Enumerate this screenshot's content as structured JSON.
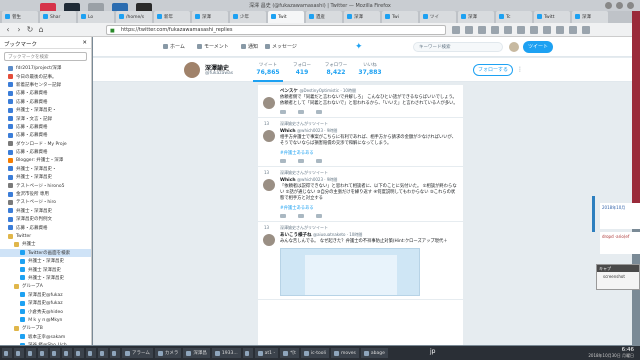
{
  "window": {
    "title": "深澤 昌史 (@fukazawamasashi) | Twitter — Mozilla Firefox"
  },
  "desktop_icons": [
    {
      "color": "#d6334a"
    },
    {
      "color": "#1e2a36"
    },
    {
      "color": "#9aa0a6"
    },
    {
      "color": "#2b6cb0"
    },
    {
      "color": "#2a2a2a"
    }
  ],
  "tabs": [
    {
      "label": "菅生"
    },
    {
      "label": "Shar"
    },
    {
      "label": "Lo"
    },
    {
      "label": "/home/s"
    },
    {
      "label": "新年"
    },
    {
      "label": "深澤"
    },
    {
      "label": "少年"
    },
    {
      "label": "Twit"
    },
    {
      "label": "遺産"
    },
    {
      "label": "深澤"
    },
    {
      "label": "Twi"
    },
    {
      "label": "ツイ"
    },
    {
      "label": "深澤"
    },
    {
      "label": "Tc"
    },
    {
      "label": "Twitt"
    },
    {
      "label": "深澤"
    }
  ],
  "navbar": {
    "url": "https://twitter.com/fukazawamasashi_replies"
  },
  "sidebar": {
    "title": "ブックマーク",
    "search_placeholder": "ブックマークを検索",
    "items": [
      {
        "label": "fdr2017/project/深澤",
        "level": 0,
        "folder": false,
        "color": "#5b8cc9"
      },
      {
        "label": "今日の最後の記事。",
        "level": 0,
        "folder": false,
        "color": "#e44d3a"
      },
      {
        "label": "新着記事センター記録",
        "level": 0,
        "folder": false,
        "color": "#3b7dd8"
      },
      {
        "label": "応募・応募資格",
        "level": 0,
        "folder": false,
        "color": "#3b7dd8"
      },
      {
        "label": "応募・応募資格",
        "level": 0,
        "folder": false,
        "color": "#3b7dd8"
      },
      {
        "label": "弁護士・深澤昌史・",
        "level": 0,
        "folder": false,
        "color": "#3b7dd8"
      },
      {
        "label": "深澤・文言・記録",
        "level": 0,
        "folder": false,
        "color": "#3b7dd8"
      },
      {
        "label": "応募・応募資格",
        "level": 0,
        "folder": false,
        "color": "#3b7dd8"
      },
      {
        "label": "応募・応募資格",
        "level": 0,
        "folder": false,
        "color": "#3b7dd8"
      },
      {
        "label": "ダウンロード - My Proje",
        "level": 0,
        "folder": false,
        "color": "#7a7a7a"
      },
      {
        "label": "応募・応募資格",
        "level": 0,
        "folder": false,
        "color": "#3b7dd8"
      },
      {
        "label": "Blogger: 弁護士・深澤",
        "level": 0,
        "folder": false,
        "color": "#f57d00"
      },
      {
        "label": "弁護士・深澤昌史・",
        "level": 0,
        "folder": false,
        "color": "#3b7dd8"
      },
      {
        "label": "弁護士・深澤昌史",
        "level": 0,
        "folder": false,
        "color": "#3b7dd8"
      },
      {
        "label": "テストページ・hirono5",
        "level": 0,
        "folder": false,
        "color": "#7a7a7a"
      },
      {
        "label": "金沢市役所 専用",
        "level": 0,
        "folder": false,
        "color": "#3b7dd8"
      },
      {
        "label": "テストページ・hiro",
        "level": 0,
        "folder": false,
        "color": "#7a7a7a"
      },
      {
        "label": "弁護士・深澤昌史",
        "level": 0,
        "folder": false,
        "color": "#3b7dd8"
      },
      {
        "label": "深澤昌史の判例文",
        "level": 0,
        "folder": false,
        "color": "#3b7dd8"
      },
      {
        "label": "応募・応募資格",
        "level": 0,
        "folder": false,
        "color": "#3b7dd8"
      },
      {
        "label": "Twitter",
        "level": 0,
        "folder": true,
        "color": "#e0b64a"
      },
      {
        "label": "弁護士",
        "level": 1,
        "folder": true,
        "color": "#e0b64a"
      },
      {
        "label": "Twitterの画面を検索",
        "level": 2,
        "folder": false,
        "color": "#1da1f2",
        "selected": true
      },
      {
        "label": "弁護士・深澤昌史",
        "level": 2,
        "folder": false,
        "color": "#1da1f2"
      },
      {
        "label": "弁護士 深澤昌史",
        "level": 2,
        "folder": false,
        "color": "#1da1f2"
      },
      {
        "label": "弁護士・深澤昌史",
        "level": 2,
        "folder": false,
        "color": "#1da1f2"
      },
      {
        "label": "グループA",
        "level": 1,
        "folder": true,
        "color": "#e0b64a"
      },
      {
        "label": "深澤昌史@fukaz",
        "level": 2,
        "folder": false,
        "color": "#1da1f2"
      },
      {
        "label": "深澤昌史@fukaz",
        "level": 2,
        "folder": false,
        "color": "#1da1f2"
      },
      {
        "label": "小倉秀夫@hideo",
        "level": 2,
        "folder": false,
        "color": "#1da1f2"
      },
      {
        "label": "Ｍｋｙｎ@Mkyn",
        "level": 2,
        "folder": false,
        "color": "#1da1f2"
      },
      {
        "label": "グループB",
        "level": 1,
        "folder": true,
        "color": "#e0b64a"
      },
      {
        "label": "坂本正幸@sakam",
        "level": 2,
        "folder": false,
        "color": "#1da1f2"
      },
      {
        "label": "深谷 修@Sho_Uch",
        "level": 2,
        "folder": false,
        "color": "#1da1f2"
      },
      {
        "label": "相澤 明@akir",
        "level": 2,
        "folder": false,
        "color": "#1da1f2"
      },
      {
        "label": "深澤(ソウ)グラ",
        "level": 2,
        "folder": false,
        "color": "#1da1f2"
      },
      {
        "label": "深澤昌史@fukaz",
        "level": 2,
        "folder": false,
        "color": "#1da1f2"
      }
    ]
  },
  "twitter": {
    "nav": {
      "home": "ホーム",
      "moments": "モーメント",
      "notifications": "通知",
      "messages": "メッセージ",
      "search_placeholder": "キーワード検索",
      "tweet_button": "ツイート"
    },
    "profile": {
      "name": "深澤諭史",
      "handle": "@fukazawas",
      "stats": [
        {
          "label": "ツイート",
          "value": "76,865"
        },
        {
          "label": "フォロー",
          "value": "419"
        },
        {
          "label": "フォロワー",
          "value": "8,422"
        },
        {
          "label": "いいね",
          "value": "37,883"
        }
      ],
      "follow_button": "フォローする"
    },
    "tweets": [
      {
        "rt_count": "",
        "retweeted_by": "",
        "name": "ベンスケ",
        "handle": "@DestinyOptimistic · 10時間",
        "text": "依頼者側で「同義だと言わないで弁解しろ」 こんなひとい話ができるならばいいでしょう。依頼者として「同義と言わないで」と思われるから、「いいえ」と言わされている人が多い。",
        "tag": ""
      },
      {
        "rt_count": "13",
        "retweeted_by": "深澤諭史さんがリツイート",
        "name": "Which",
        "handle": "@which0023 · 9時間",
        "text": "相手方弁護士で事案がこちらに有利であれば、相手方から請求の金額が少なければいいが、そうでないならば損害賠償の交渉で和解になってしまう。",
        "tag": "#弁護士あるある"
      },
      {
        "rt_count": "13",
        "retweeted_by": "深澤諭史さんがリツイート",
        "name": "Which",
        "handle": "@which0023 · 9時間",
        "text": "「依頼者は説得できない」と思われて相談者に、以下のことに気付いた。 ①相談が終わらない ②話が通じない ③自分の主張だけを繰り返す ④何度説明してもわからない ⑤これらの状態で相手方と対立する",
        "tag": "#弁護士あるある"
      },
      {
        "rt_count": "13",
        "retweeted_by": "深澤諭史さんがリツイート",
        "name": "あいこう様子ね",
        "handle": "@aiusuatnaketo · 10時間",
        "text": "みんな苦しんでる。 なぜ起きた？弁護士の不祥事防止対策(Hint:クローズアップ現代＋",
        "tag": ""
      }
    ]
  },
  "desktop": {
    "widget1_text": "2018年10月",
    "widget2_text": "dropd ·ario(ef",
    "mini_title": "キャプ",
    "mini_body": "screenshot"
  },
  "taskbar": {
    "items": [
      {
        "label": "",
        "small": true
      },
      {
        "label": "",
        "small": true
      },
      {
        "label": "",
        "small": true
      },
      {
        "label": "",
        "small": true
      },
      {
        "label": "",
        "small": true
      },
      {
        "label": "",
        "small": true
      },
      {
        "label": "",
        "small": true
      },
      {
        "label": "",
        "small": true
      },
      {
        "label": "",
        "small": true
      },
      {
        "label": "",
        "small": true
      },
      {
        "label": "アラーム",
        "small": false
      },
      {
        "label": "カメラ",
        "small": false
      },
      {
        "label": "深澤昌",
        "small": false
      },
      {
        "label": "1933...",
        "small": false
      },
      {
        "label": "",
        "small": true
      },
      {
        "label": "at1 -",
        "small": false
      },
      {
        "label": "*[t",
        "small": false
      },
      {
        "label": "ic-tooli",
        "small": false
      },
      {
        "label": "moves",
        "small": false
      },
      {
        "label": "abage",
        "small": false
      }
    ],
    "ime": "jp",
    "time": "6:46",
    "date": "2018年10月30日 月曜日"
  }
}
